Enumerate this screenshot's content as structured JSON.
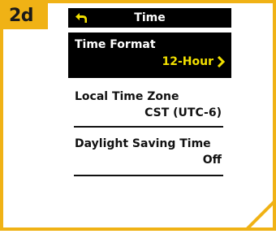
{
  "step_badge": "2d",
  "header": {
    "title": "Time",
    "back_icon": "back-arrow-icon"
  },
  "settings": [
    {
      "label": "Time Format",
      "value": "12-Hour",
      "selected": true,
      "icon": "chevron-right-icon"
    },
    {
      "label": "Local Time Zone",
      "value": "CST (UTC-6)",
      "selected": false
    },
    {
      "label": "Daylight Saving Time",
      "value": "Off",
      "selected": false
    }
  ],
  "colors": {
    "accent": "#f0b215",
    "screen_bg": "#000000",
    "selected_value": "#f2e000"
  }
}
